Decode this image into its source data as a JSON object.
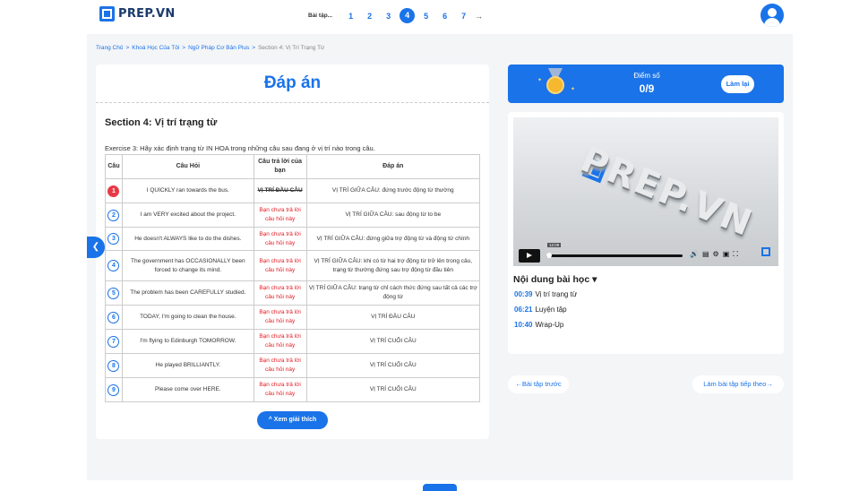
{
  "header": {
    "logo_text": "PREP.VN",
    "pager_label": "Bài tập...",
    "pages": [
      "1",
      "2",
      "3",
      "4",
      "5",
      "6",
      "7"
    ],
    "active_page": "4",
    "next_arrow": "→"
  },
  "breadcrumb": {
    "items": [
      "Trang Chủ",
      "Khoá Học Của Tôi",
      "Ngữ Pháp Cơ Bản Plus"
    ],
    "current": "Section 4: Vị Trí Trạng Từ",
    "separator": ">"
  },
  "answer_panel": {
    "title": "Đáp án",
    "section_title": "Section 4: Vị trí trạng từ",
    "exercise_text": "Exercise 3: Hãy xác định trạng từ IN HOA trong những câu sau đang ở vị trí nào trong câu.",
    "columns": [
      "Câu",
      "Câu Hỏi",
      "Câu trả lời của bạn",
      "Đáp án"
    ],
    "rows": [
      {
        "num": "1",
        "status": "wrong",
        "question": "I QUICKLY ran towards the bus.",
        "your_answer": "VỊ TRÍ ĐẦU CÂU",
        "answer": "VỊ TRÍ GIỮA CÂU: đứng trước động từ thường"
      },
      {
        "num": "2",
        "status": "none",
        "question": "I am VERY excited about the project.",
        "your_answer": "Bạn chưa trả lời câu hỏi này",
        "answer": "VỊ TRÍ GIỮA CÂU: sau động từ to be"
      },
      {
        "num": "3",
        "status": "none",
        "question": "He doesn't ALWAYS like to do the dishes.",
        "your_answer": "Bạn chưa trả lời câu hỏi này",
        "answer": "VỊ TRÍ GIỮA CÂU: đứng giữa trợ động từ và động từ chính"
      },
      {
        "num": "4",
        "status": "none",
        "question": "The government has OCCASIONALLY been forced to change its mind.",
        "your_answer": "Bạn chưa trả lời câu hỏi này",
        "answer": "VỊ TRÍ GIỮA CÂU: khi có từ hai trợ động từ trở lên trong câu, trạng từ thường đứng sau trợ động từ đầu tiên"
      },
      {
        "num": "5",
        "status": "none",
        "question": "The problem has been CAREFULLY studied.",
        "your_answer": "Bạn chưa trả lời câu hỏi này",
        "answer": "VỊ TRÍ GIỮA CÂU: trạng từ chỉ cách thức đứng sau tất cả các trợ động từ"
      },
      {
        "num": "6",
        "status": "none",
        "question": "TODAY, I'm going to clean the house.",
        "your_answer": "Bạn chưa trả lời câu hỏi này",
        "answer": "VỊ TRÍ ĐẦU CÂU"
      },
      {
        "num": "7",
        "status": "none",
        "question": "I'm flying to Edinburgh TOMORROW.",
        "your_answer": "Bạn chưa trả lời câu hỏi này",
        "answer": "VỊ TRÍ CUỐI CÂU"
      },
      {
        "num": "8",
        "status": "none",
        "question": "He played BRILLIANTLY.",
        "your_answer": "Bạn chưa trả lời câu hỏi này",
        "answer": "VỊ TRÍ CUỐI CÂU"
      },
      {
        "num": "9",
        "status": "none",
        "question": "Please come over HERE.",
        "your_answer": "Bạn chưa trả lời câu hỏi này",
        "answer": "VỊ TRÍ CUỐI CÂU"
      }
    ],
    "explain_button": "^ Xem giải thích"
  },
  "side_toggle_icon": "chevron-left-icon",
  "score": {
    "label": "Điểm số",
    "value": "0/9",
    "retry_button": "Làm lại",
    "medal_icon": "medal-icon"
  },
  "video": {
    "brand_text": "PREP.VN",
    "time_display": "12:09",
    "progress_fraction": 0.0
  },
  "lesson": {
    "title": "Nội dung bài học ▾",
    "items": [
      {
        "time": "00:39",
        "label": "Vị trí trạng từ"
      },
      {
        "time": "06:21",
        "label": "Luyện tập"
      },
      {
        "time": "10:40",
        "label": "Wrap-Up"
      }
    ]
  },
  "navigation": {
    "prev": "←Bài tập trước",
    "next": "Làm bài tập tiếp theo→"
  },
  "colors": {
    "primary": "#1a73e8",
    "wrong": "#e63946",
    "unanswered_text": "#e31b23",
    "background": "#f4f5f7"
  }
}
